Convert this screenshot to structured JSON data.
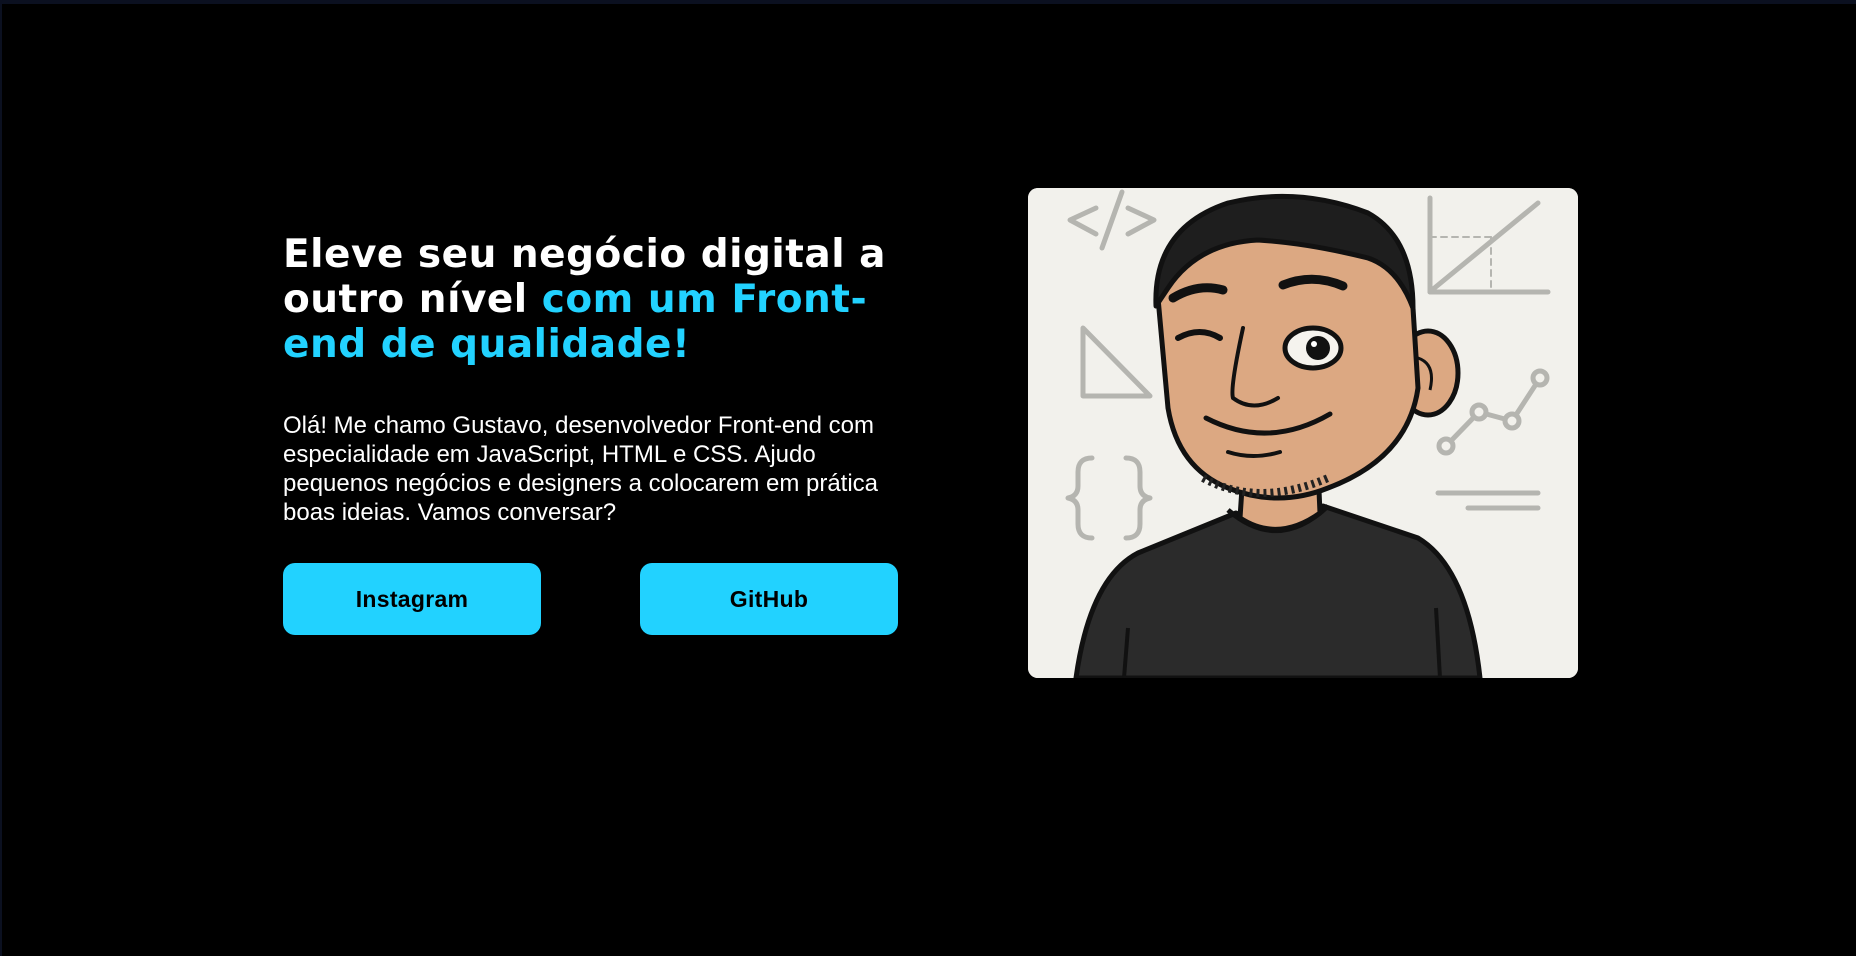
{
  "hero": {
    "headline_white": "Eleve seu negócio digital a outro nível ",
    "headline_accent": "com um Front-end de qualidade!",
    "intro": "Olá! Me chamo Gustavo, desenvolvedor Front-end com especialidade em JavaScript, HTML e CSS. Ajudo pequenos negócios e designers a colocarem em prática boas ideias. Vamos conversar?"
  },
  "buttons": {
    "instagram_label": "Instagram",
    "github_label": "GitHub"
  },
  "avatar": {
    "icon": "winking-developer-avatar"
  },
  "colors": {
    "background": "#000000",
    "accent": "#22d2ff",
    "text": "#ffffff",
    "card": "#f2f1ec"
  }
}
